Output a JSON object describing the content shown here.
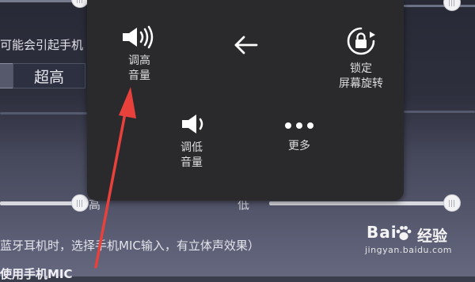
{
  "background_app": {
    "warning_text": "可能会引起手机",
    "mode_option": "超高",
    "slider_high_label": "高",
    "slider_low_label": "低",
    "note_text": "蓝牙耳机时，选择手机MIC输入，有立体声效果）",
    "bottom_text": "使用手机MIC"
  },
  "quick_panel": {
    "volume_up": {
      "icon": "volume-up-icon",
      "line1": "调高",
      "line2": "音量"
    },
    "back": {
      "icon": "back-arrow-icon"
    },
    "lock_rotation": {
      "icon": "rotation-lock-icon",
      "line1": "锁定",
      "line2": "屏幕旋转"
    },
    "volume_down": {
      "icon": "volume-down-icon",
      "line1": "调低",
      "line2": "音量"
    },
    "more": {
      "icon": "more-dots-icon",
      "label": "更多"
    }
  },
  "annotation": {
    "color": "#e8413c"
  },
  "watermark": {
    "brand_a": "Bai",
    "brand_b": "经验",
    "url": "jingyan.baidu.com"
  }
}
